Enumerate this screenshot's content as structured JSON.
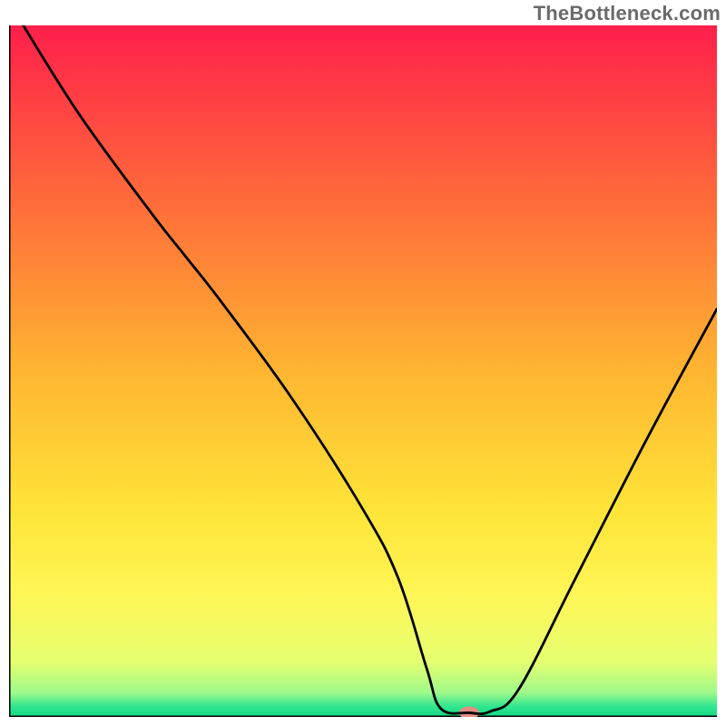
{
  "watermark": "TheBottleneck.com",
  "chart_data": {
    "type": "line",
    "title": "",
    "xlabel": "",
    "ylabel": "",
    "xlim": [
      0,
      100
    ],
    "ylim": [
      0,
      100
    ],
    "grid": false,
    "legend": false,
    "background_gradient_stops": [
      {
        "offset": 0.0,
        "color": "#ff1f4b"
      },
      {
        "offset": 0.25,
        "color": "#ff6a3a"
      },
      {
        "offset": 0.5,
        "color": "#ffb531"
      },
      {
        "offset": 0.7,
        "color": "#ffe438"
      },
      {
        "offset": 0.82,
        "color": "#fff555"
      },
      {
        "offset": 0.92,
        "color": "#e6ff70"
      },
      {
        "offset": 0.965,
        "color": "#9ef98a"
      },
      {
        "offset": 0.985,
        "color": "#2fe68f"
      },
      {
        "offset": 1.0,
        "color": "#17d885"
      }
    ],
    "series": [
      {
        "name": "bottleneck-curve",
        "x": [
          2,
          10,
          20,
          25,
          30,
          40,
          50,
          55,
          59,
          61,
          65,
          68,
          72,
          80,
          90,
          100
        ],
        "y": [
          100,
          87,
          73,
          66.5,
          60,
          46,
          30,
          20,
          7,
          1.2,
          0.6,
          0.8,
          4,
          20,
          40,
          59
        ],
        "stroke": "#000000",
        "stroke_width": 2.8
      }
    ],
    "marker": {
      "name": "optimal-point",
      "x": 65,
      "y": 0.6,
      "rx": 11,
      "ry": 7,
      "fill": "#e38d84"
    },
    "axes": {
      "stroke": "#000000",
      "stroke_width": 3
    }
  }
}
